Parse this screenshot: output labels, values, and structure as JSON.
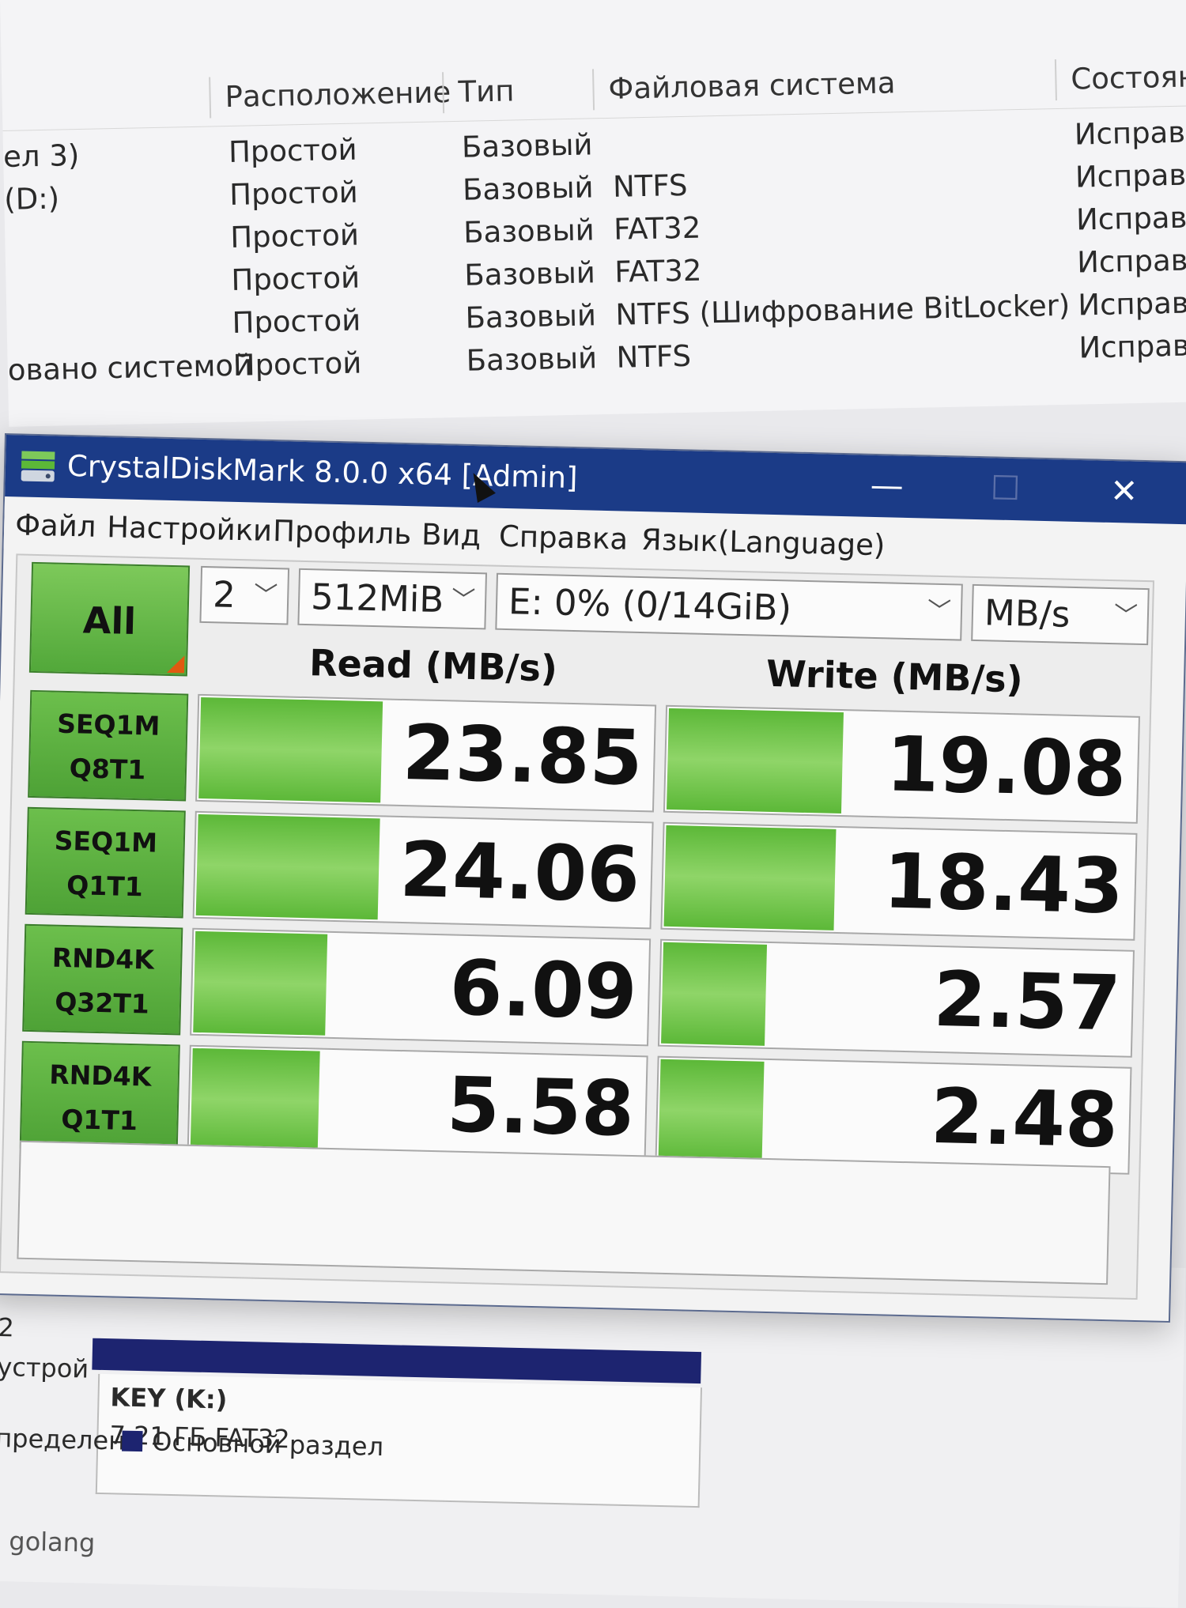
{
  "volume_list": {
    "columns": [
      "Расположение",
      "Тип",
      "Файловая система",
      "Состоян"
    ],
    "left_fragments": [
      "ел 3)",
      "(D:)",
      "",
      "",
      "",
      "овано системой"
    ],
    "rows": [
      {
        "layout": "Простой",
        "type": "Базовый",
        "fs": "",
        "status": "Исправ"
      },
      {
        "layout": "Простой",
        "type": "Базовый",
        "fs": "NTFS",
        "status": "Исправ"
      },
      {
        "layout": "Простой",
        "type": "Базовый",
        "fs": "FAT32",
        "status": "Исправе"
      },
      {
        "layout": "Простой",
        "type": "Базовый",
        "fs": "FAT32",
        "status": "Исправе"
      },
      {
        "layout": "Простой",
        "type": "Базовый",
        "fs": "NTFS (Шифрование BitLocker)",
        "status": "Исправе"
      },
      {
        "layout": "Простой",
        "type": "Базовый",
        "fs": "NTFS",
        "status": "Исправе"
      }
    ]
  },
  "cdm": {
    "title": "CrystalDiskMark 8.0.0 x64 [Admin]",
    "window_buttons": {
      "minimize": "—",
      "maximize": "☐",
      "close": "✕"
    },
    "menu": [
      "Файл",
      "Настройки",
      "Профиль",
      "Вид",
      "Справка",
      "Язык(Language)"
    ],
    "all_label": "All",
    "count": "2",
    "size": "512MiB",
    "drive": "E: 0% (0/14GiB)",
    "unit": "MB/s",
    "read_header": "Read (MB/s)",
    "write_header": "Write (MB/s)",
    "tests": [
      {
        "line1": "SEQ1M",
        "line2": "Q8T1",
        "read": "23.85",
        "write": "19.08",
        "read_fill": 0.4,
        "write_fill": 0.37
      },
      {
        "line1": "SEQ1M",
        "line2": "Q1T1",
        "read": "24.06",
        "write": "18.43",
        "read_fill": 0.4,
        "write_fill": 0.36
      },
      {
        "line1": "RND4K",
        "line2": "Q32T1",
        "read": "6.09",
        "write": "2.57",
        "read_fill": 0.29,
        "write_fill": 0.22
      },
      {
        "line1": "RND4K",
        "line2": "Q1T1",
        "read": "5.58",
        "write": "2.48",
        "read_fill": 0.28,
        "write_fill": 0.22
      }
    ],
    "accent_green": "#5cb838",
    "title_bar_color": "#1b3b87"
  },
  "disk_map": {
    "disk_number": "2",
    "device_fragment": "устрой",
    "volume_name": "KEY  (K:)",
    "volume_size": "7.21 ГБ FAT32",
    "legend_unallocated": "пределена",
    "legend_primary": "Основной раздел",
    "footer_fragment": "golang"
  }
}
